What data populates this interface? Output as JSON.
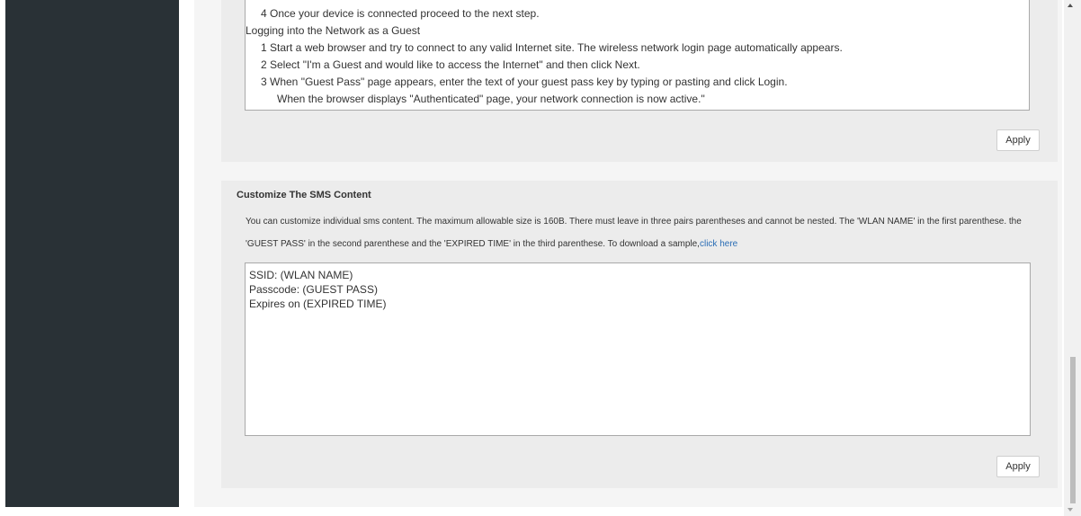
{
  "instructions": {
    "lines": [
      "4  Once your device is connected proceed to the next step.",
      "Logging into the Network as a Guest",
      "1  Start a web browser and try to connect to any valid Internet site. The wireless network login page automatically appears.",
      "2  Select \"I'm a Guest and would like to access the Internet\" and then click Next.",
      "3  When \"Guest Pass\" page appears, enter the text of your guest pass key by typing or pasting and click Login.",
      "When the browser displays  \"Authenticated\" page, your network connection is now active.\""
    ]
  },
  "buttons": {
    "apply_top": "Apply",
    "apply_bottom": "Apply"
  },
  "sms": {
    "title": "Customize The SMS Content",
    "description": "You can customize individual sms content. The maximum allowable size is 160B. There must leave in three pairs parentheses and cannot be nested. The 'WLAN NAME' in the first parenthese. the 'GUEST PASS' in the second parenthese and the 'EXPIRED TIME' in the third parenthese. To download a sample,",
    "link_text": "click here",
    "content_lines": [
      "SSID: (WLAN NAME)",
      "Passcode: (GUEST PASS)",
      "Expires on (EXPIRED TIME)"
    ]
  },
  "colors": {
    "sidebar": "#293136",
    "panel": "#ececec",
    "link": "#2a6db5"
  }
}
